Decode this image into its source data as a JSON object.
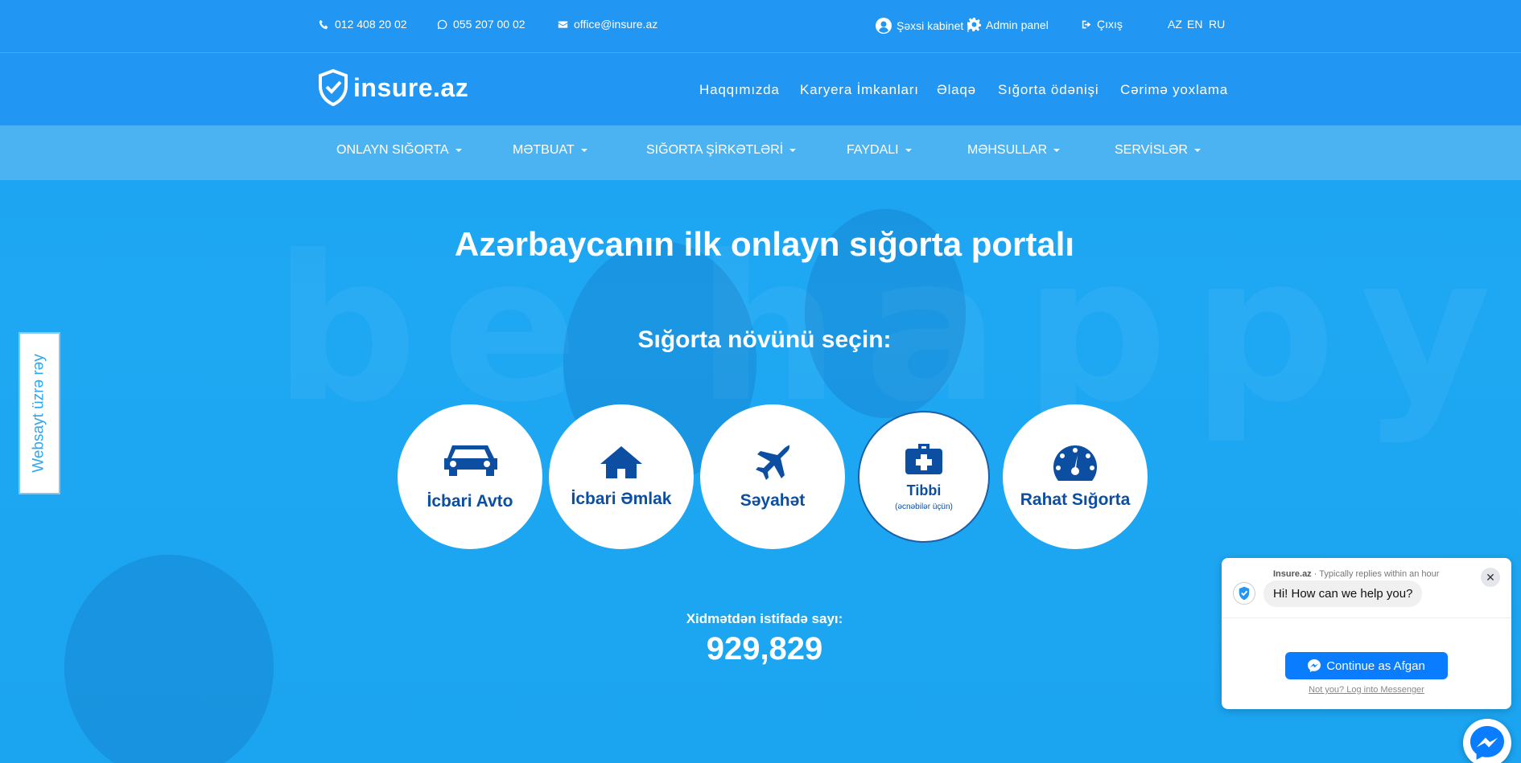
{
  "topbar": {
    "phone1": "012 408 20 02",
    "phone2": "055 207 00 02",
    "email": "office@insure.az",
    "personal_cabinet": "Şəxsi kabinet |",
    "admin_panel": "Admin panel",
    "logout": "Çıxış",
    "languages": [
      "AZ",
      "EN",
      "RU"
    ]
  },
  "header": {
    "logo_text": "insure.az",
    "nav": [
      "Haqqımızda",
      "Karyera İmkanları",
      "Əlaqə",
      "Sığorta ödənişi",
      "Cərimə yoxlama"
    ]
  },
  "menu": [
    "ONLAYN SIĞORTA",
    "MƏTBUAT",
    "SIĞORTA ŞİRKƏTLƏRİ",
    "FAYDALI",
    "MƏHSULLAR",
    "SERVİSLƏR"
  ],
  "hero": {
    "watermark": "be happy",
    "title": "Azərbaycanın ilk onlayn sığorta portalı",
    "subtitle": "Sığorta növünü seçin:",
    "options": [
      {
        "label": "İcbari Avto",
        "icon": "car-icon"
      },
      {
        "label": "İcbari Əmlak",
        "icon": "home-icon"
      },
      {
        "label": "Səyahət",
        "icon": "plane-icon"
      },
      {
        "label": "Tibbi",
        "note": "(əcnəbilər üçün)",
        "icon": "medkit-icon"
      },
      {
        "label": "Rahat Sığorta",
        "icon": "speedometer-icon"
      }
    ],
    "usage_label": "Xidmətdən istifadə sayı:",
    "usage_count": "929,829"
  },
  "feedback": {
    "label": "Websayt üzrə rəy"
  },
  "chat": {
    "name": "Insure.az",
    "status": " · Typically replies within an hour",
    "message": "Hi! How can we help you?",
    "button": "Continue as Afgan",
    "link": "Not you? Log into Messenger",
    "close": "✕"
  },
  "colors": {
    "brand_blue": "#2196f3",
    "menu_blue": "#4cb3f3",
    "icon_navy": "#0b4ea2",
    "messenger_blue": "#0a7cff"
  }
}
